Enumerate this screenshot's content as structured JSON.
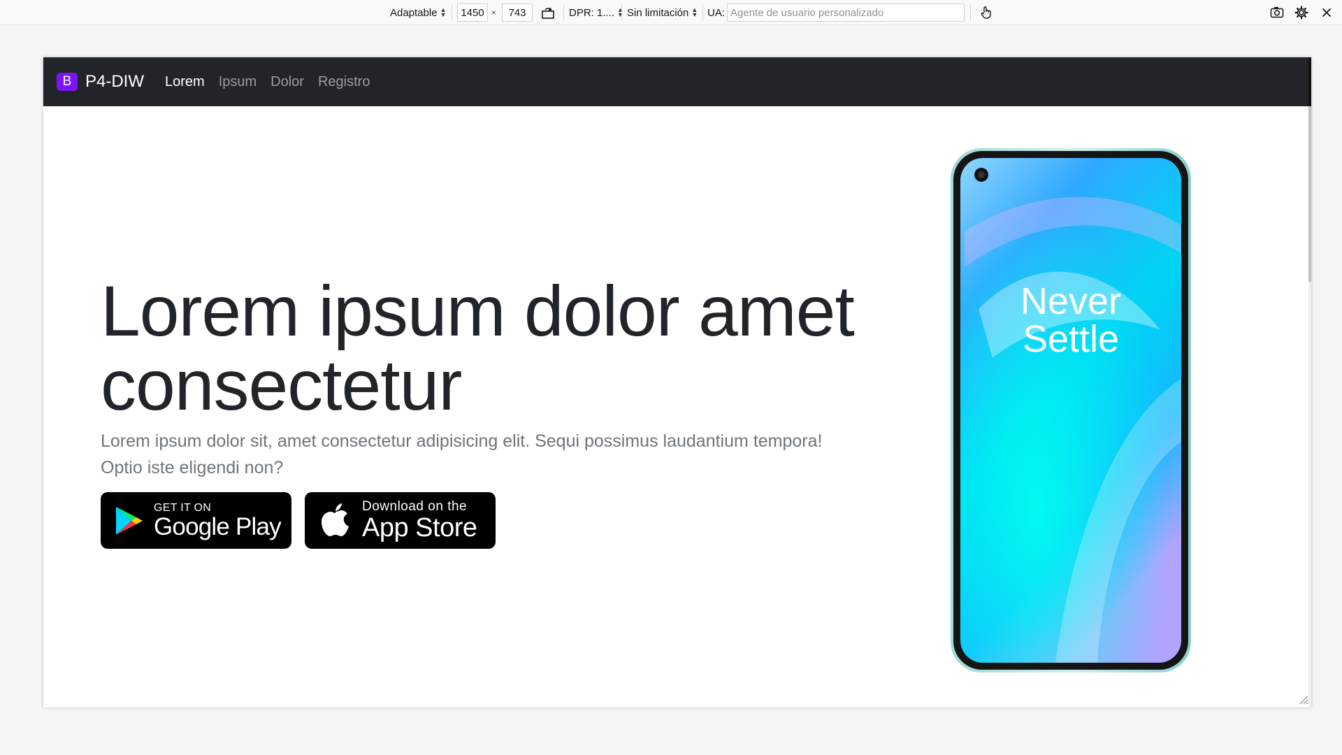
{
  "toolbar": {
    "device_label": "Adaptable",
    "width_value": "1450",
    "times": "×",
    "height_value": "743",
    "dpr_label": "DPR: 1....",
    "throttle_label": "Sin limitación",
    "ua_label": "UA:",
    "ua_placeholder": "Agente de usuario personalizado"
  },
  "navbar": {
    "brand_logo": "B",
    "brand_name": "P4-DIW",
    "links": [
      {
        "label": "Lorem",
        "active": true
      },
      {
        "label": "Ipsum",
        "active": false
      },
      {
        "label": "Dolor",
        "active": false
      },
      {
        "label": "Registro",
        "active": false
      }
    ]
  },
  "hero": {
    "title": "Lorem ipsum dolor amet consectetur",
    "lead": "Lorem ipsum dolor sit, amet consectetur adipisicing elit. Sequi possimus laudantium tempora! Optio iste eligendi non?"
  },
  "stores": {
    "google": {
      "small": "GET IT ON",
      "big": "Google Play"
    },
    "apple": {
      "small": "Download on the",
      "big": "App Store"
    }
  },
  "phone": {
    "screen_text_1": "Never",
    "screen_text_2": "Settle"
  },
  "colors": {
    "navbar_bg": "#212529",
    "brand_logo_bg": "#7b14f5",
    "lead_text": "#6c757d"
  }
}
